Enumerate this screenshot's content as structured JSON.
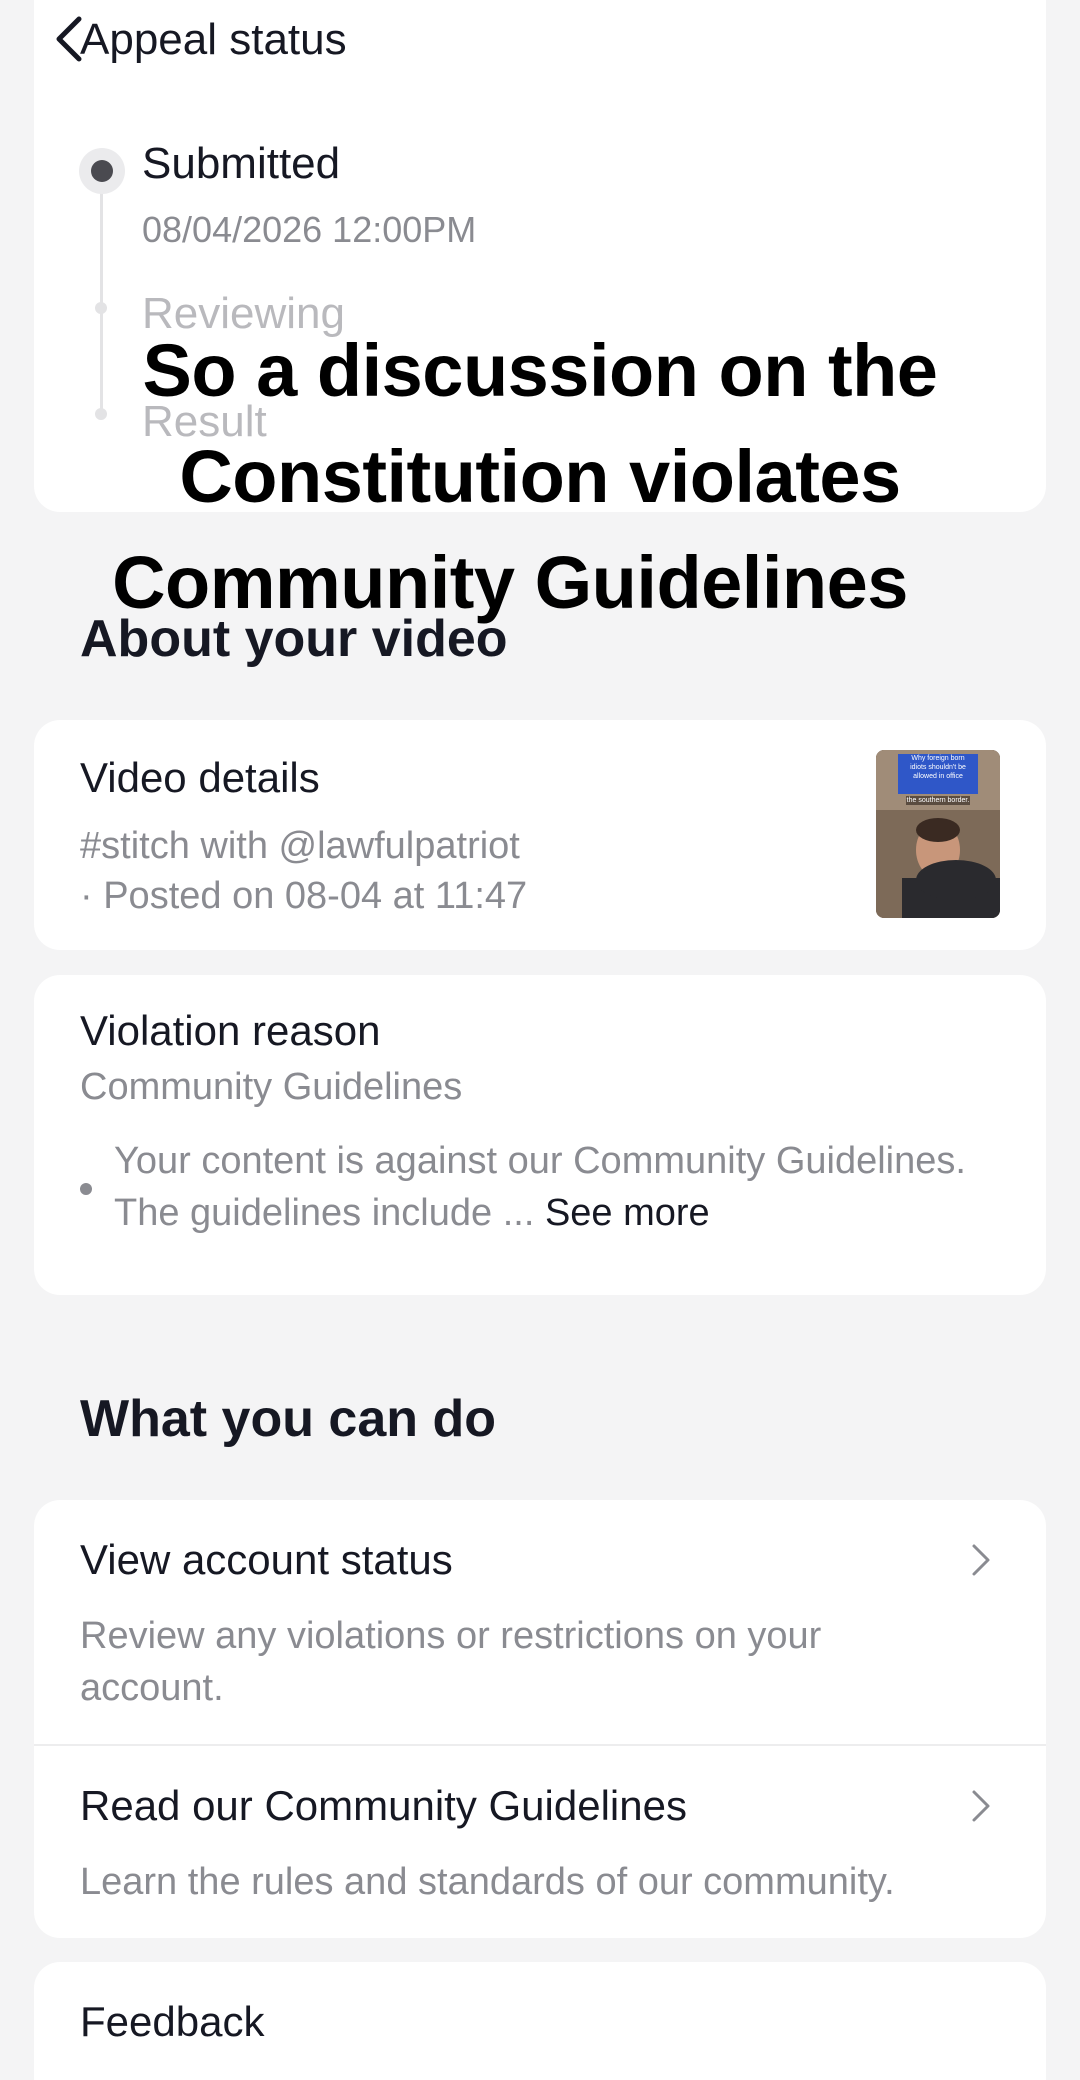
{
  "header": {
    "title": "Appeal status",
    "back_icon": "chevron-left-icon"
  },
  "timeline": {
    "steps": [
      {
        "label": "Submitted",
        "time": "08/04/2026 12:00PM",
        "state": "active"
      },
      {
        "label": "Reviewing",
        "state": "pending"
      },
      {
        "label": "Result",
        "state": "pending"
      }
    ]
  },
  "overlay_caption": {
    "lines": [
      "So a discussion on the",
      "Constitution violates",
      "Community Guidelines"
    ]
  },
  "about_video": {
    "section_title": "About your video",
    "card_title": "Video details",
    "line1": "#stitch with @lawfulpatriot",
    "line2": "· Posted on 08-04 at 11:47",
    "thumbnail": {
      "caption_line1": "Why foreign born",
      "caption_line2": "idiots shouldn't be",
      "caption_line3": "allowed in office",
      "caption_line4": "the southern border."
    }
  },
  "violation": {
    "title": "Violation reason",
    "category": "Community Guidelines",
    "bullet": "Your content is against our Community Guidelines. The guidelines include ...",
    "see_more": "See more"
  },
  "what_you_can_do": {
    "section_title": "What you can do",
    "items": [
      {
        "title": "View account status",
        "desc": "Review any violations or restrictions on your account.",
        "icon": "chevron-right-icon"
      },
      {
        "title": "Read our Community Guidelines",
        "desc": "Learn the rules and standards of our community.",
        "icon": "chevron-right-icon"
      }
    ]
  },
  "feedback": {
    "title": "Feedback"
  },
  "colors": {
    "background": "#f4f4f5",
    "card": "#ffffff",
    "primary_text": "#161823",
    "secondary_text": "#8a8b91",
    "pending_text": "#b9b9bd"
  }
}
